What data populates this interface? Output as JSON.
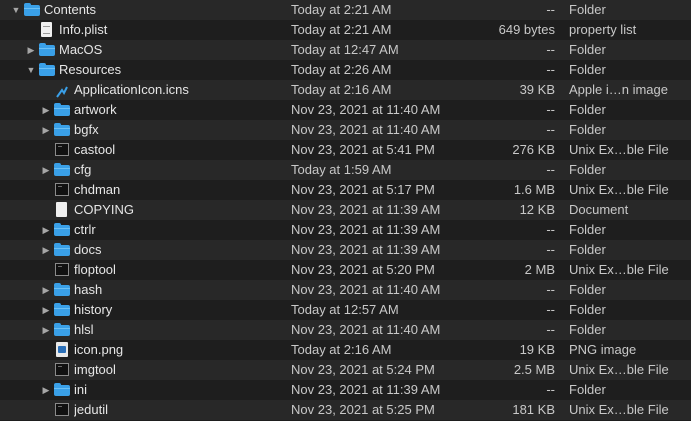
{
  "rows": [
    {
      "name": "Contents",
      "date": "Today at 2:21 AM",
      "size": "--",
      "kind": "Folder",
      "type": "folder",
      "expanded": true,
      "disclosure": true,
      "depth": 0
    },
    {
      "name": "Info.plist",
      "date": "Today at 2:21 AM",
      "size": "649 bytes",
      "kind": "property list",
      "type": "plist",
      "expanded": false,
      "disclosure": false,
      "depth": 1
    },
    {
      "name": "MacOS",
      "date": "Today at 12:47 AM",
      "size": "--",
      "kind": "Folder",
      "type": "folder",
      "expanded": false,
      "disclosure": true,
      "depth": 1
    },
    {
      "name": "Resources",
      "date": "Today at 2:26 AM",
      "size": "--",
      "kind": "Folder",
      "type": "folder",
      "expanded": true,
      "disclosure": true,
      "depth": 1
    },
    {
      "name": "ApplicationIcon.icns",
      "date": "Today at 2:16 AM",
      "size": "39 KB",
      "kind": "Apple i…n image",
      "type": "icns",
      "expanded": false,
      "disclosure": false,
      "depth": 2
    },
    {
      "name": "artwork",
      "date": "Nov 23, 2021 at 11:40 AM",
      "size": "--",
      "kind": "Folder",
      "type": "folder",
      "expanded": false,
      "disclosure": true,
      "depth": 2
    },
    {
      "name": "bgfx",
      "date": "Nov 23, 2021 at 11:40 AM",
      "size": "--",
      "kind": "Folder",
      "type": "folder",
      "expanded": false,
      "disclosure": true,
      "depth": 2
    },
    {
      "name": "castool",
      "date": "Nov 23, 2021 at 5:41 PM",
      "size": "276 KB",
      "kind": "Unix Ex…ble File",
      "type": "exec",
      "expanded": false,
      "disclosure": false,
      "depth": 2
    },
    {
      "name": "cfg",
      "date": "Today at 1:59 AM",
      "size": "--",
      "kind": "Folder",
      "type": "folder",
      "expanded": false,
      "disclosure": true,
      "depth": 2
    },
    {
      "name": "chdman",
      "date": "Nov 23, 2021 at 5:17 PM",
      "size": "1.6 MB",
      "kind": "Unix Ex…ble File",
      "type": "exec",
      "expanded": false,
      "disclosure": false,
      "depth": 2
    },
    {
      "name": "COPYING",
      "date": "Nov 23, 2021 at 11:39 AM",
      "size": "12 KB",
      "kind": "Document",
      "type": "doc",
      "expanded": false,
      "disclosure": false,
      "depth": 2
    },
    {
      "name": "ctrlr",
      "date": "Nov 23, 2021 at 11:39 AM",
      "size": "--",
      "kind": "Folder",
      "type": "folder",
      "expanded": false,
      "disclosure": true,
      "depth": 2
    },
    {
      "name": "docs",
      "date": "Nov 23, 2021 at 11:39 AM",
      "size": "--",
      "kind": "Folder",
      "type": "folder",
      "expanded": false,
      "disclosure": true,
      "depth": 2
    },
    {
      "name": "floptool",
      "date": "Nov 23, 2021 at 5:20 PM",
      "size": "2 MB",
      "kind": "Unix Ex…ble File",
      "type": "exec",
      "expanded": false,
      "disclosure": false,
      "depth": 2
    },
    {
      "name": "hash",
      "date": "Nov 23, 2021 at 11:40 AM",
      "size": "--",
      "kind": "Folder",
      "type": "folder",
      "expanded": false,
      "disclosure": true,
      "depth": 2
    },
    {
      "name": "history",
      "date": "Today at 12:57 AM",
      "size": "--",
      "kind": "Folder",
      "type": "folder",
      "expanded": false,
      "disclosure": true,
      "depth": 2
    },
    {
      "name": "hlsl",
      "date": "Nov 23, 2021 at 11:40 AM",
      "size": "--",
      "kind": "Folder",
      "type": "folder",
      "expanded": false,
      "disclosure": true,
      "depth": 2
    },
    {
      "name": "icon.png",
      "date": "Today at 2:16 AM",
      "size": "19 KB",
      "kind": "PNG image",
      "type": "image",
      "expanded": false,
      "disclosure": false,
      "depth": 2
    },
    {
      "name": "imgtool",
      "date": "Nov 23, 2021 at 5:24 PM",
      "size": "2.5 MB",
      "kind": "Unix Ex…ble File",
      "type": "exec",
      "expanded": false,
      "disclosure": false,
      "depth": 2
    },
    {
      "name": "ini",
      "date": "Nov 23, 2021 at 11:39 AM",
      "size": "--",
      "kind": "Folder",
      "type": "folder",
      "expanded": false,
      "disclosure": true,
      "depth": 2
    },
    {
      "name": "jedutil",
      "date": "Nov 23, 2021 at 5:25 PM",
      "size": "181 KB",
      "kind": "Unix Ex…ble File",
      "type": "exec",
      "expanded": false,
      "disclosure": false,
      "depth": 2
    }
  ],
  "colors": {
    "folder": "#3aa0e8",
    "row_alt": "#282828",
    "row_base": "#1e1e1e",
    "text": "#dcdcdc"
  }
}
